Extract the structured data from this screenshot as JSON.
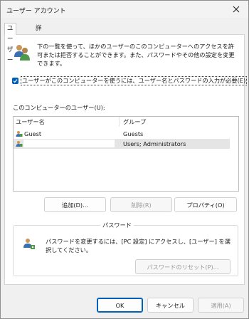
{
  "window": {
    "title": "ユーザー アカウント"
  },
  "tabs": [
    {
      "label": "ユーザー",
      "active": true
    },
    {
      "label": "詳細設定",
      "active": false
    }
  ],
  "intro": {
    "text": "下の一覧を使って、ほかのユーザーのこのコンピューターへのアクセスを許可または拒否することができます。また、パスワードやその他の設定を変更できます。"
  },
  "require_login": {
    "label": "ユーザーがこのコンピューターを使うには、ユーザー名とパスワードの入力が必要(E)",
    "checked": true
  },
  "user_list": {
    "label": "このコンピューターのユーザー(U):",
    "columns": [
      "ユーザー名",
      "グループ"
    ],
    "rows": [
      {
        "name": "Guest",
        "group": "Guests",
        "selected": false
      },
      {
        "name": "",
        "group": "Users; Administrators",
        "selected": true
      }
    ]
  },
  "list_buttons": {
    "add": "追加(D)...",
    "remove": "削除(R)",
    "properties": "プロパティ(O)"
  },
  "password": {
    "group_title": "パスワード",
    "text": "パスワードを変更するには、[PC 設定] にアクセスし、[ユーザー] を選択してください。",
    "reset_button": "パスワードのリセット(P)..."
  },
  "footer": {
    "ok": "OK",
    "cancel": "キャンセル",
    "apply": "適用(A)"
  },
  "colors": {
    "accent": "#005fb8",
    "selection": "#e5e5e5"
  }
}
